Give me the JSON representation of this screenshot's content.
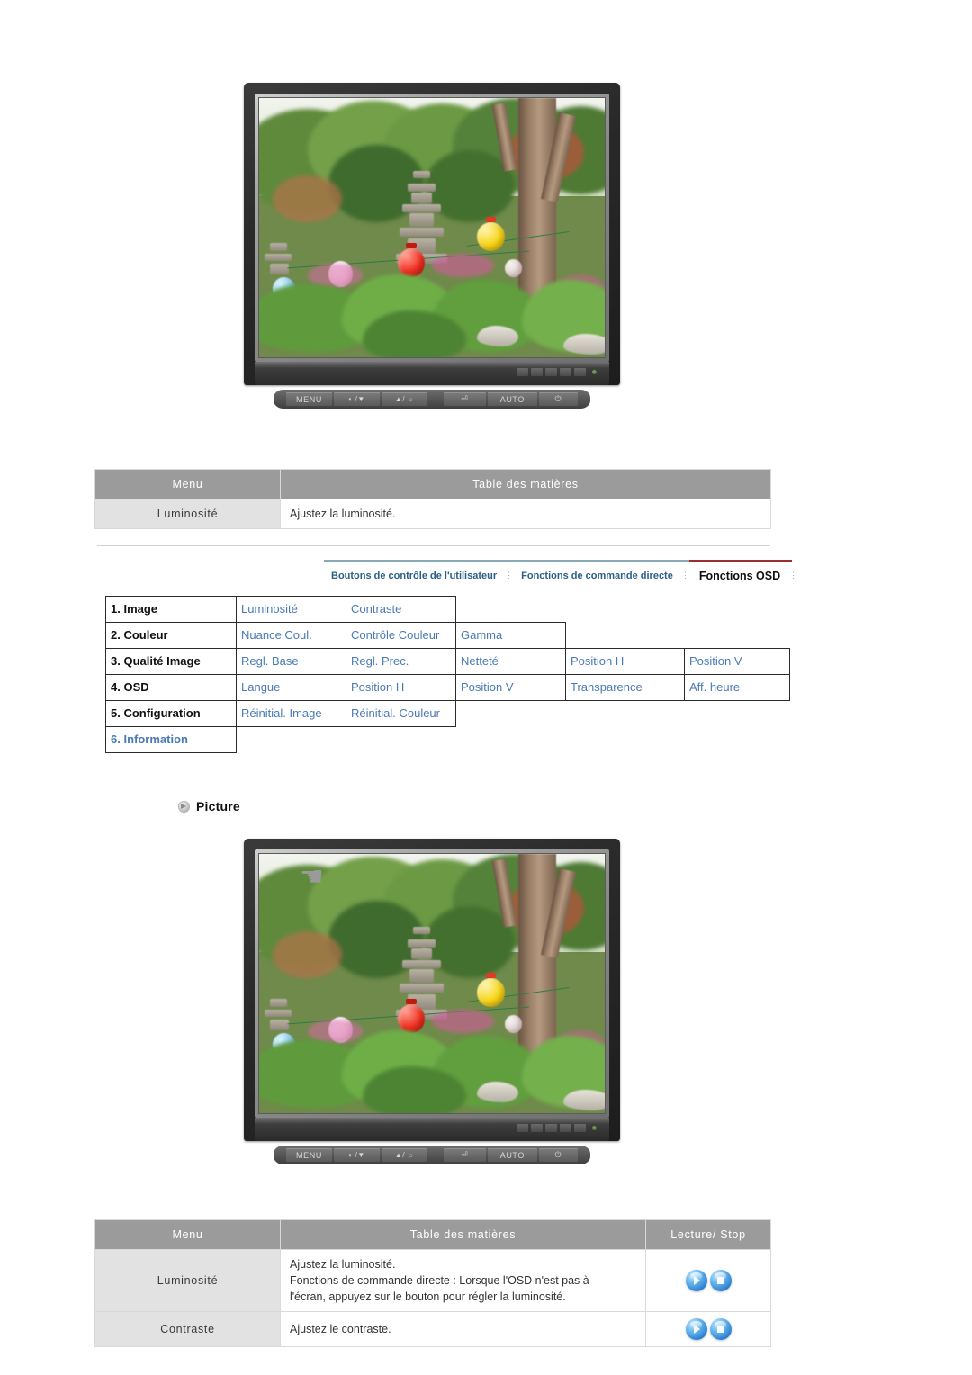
{
  "nav": {
    "items": [
      {
        "label": "Boutons de contrôle de l'utilisateur",
        "active": false
      },
      {
        "label": "Fonctions de commande directe",
        "active": false
      },
      {
        "label": "Fonctions OSD",
        "active": true
      }
    ],
    "separator": "⋮",
    "rule_color": "#8aa9b8",
    "active_rule_color": "#9c2f2f"
  },
  "monitor": {
    "buttons": {
      "menu": "MENU",
      "down": "/▼",
      "up": "▲/",
      "enter": "⏎",
      "auto": "AUTO",
      "power": "⏻"
    },
    "led_color": "#6fbf3a"
  },
  "table_top": {
    "headers": {
      "menu": "Menu",
      "contents": "Table des matières"
    },
    "rows": [
      {
        "menu": "Luminosité",
        "description": "Ajustez la luminosité."
      }
    ]
  },
  "structure_table": {
    "rows": [
      {
        "label": "1. Image",
        "label_style": "black",
        "items": [
          "Luminosité",
          "Contraste"
        ]
      },
      {
        "label": "2. Couleur",
        "label_style": "black",
        "items": [
          "Nuance Coul.",
          "Contrôle Couleur",
          "Gamma"
        ]
      },
      {
        "label": "3. Qualité Image",
        "label_style": "black",
        "items": [
          "Regl. Base",
          "Regl. Prec.",
          "Netteté",
          "Position H",
          "Position V"
        ]
      },
      {
        "label": "4. OSD",
        "label_style": "black",
        "items": [
          "Langue",
          "Position H",
          "Position V",
          "Transparence",
          "Aff. heure"
        ]
      },
      {
        "label": "5. Configuration",
        "label_style": "black",
        "items": [
          "Réinitial. Image",
          "Réinitial. Couleur"
        ]
      },
      {
        "label": "6. Information",
        "label_style": "blue",
        "items": []
      }
    ],
    "text_color": "#4a7ab5",
    "border_color": "#2b2b2b"
  },
  "picture_section": {
    "title": "Picture",
    "bullet_icon": "disc-arrow-icon"
  },
  "table_bottom": {
    "headers": {
      "menu": "Menu",
      "contents": "Table des matières",
      "control": "Lecture/ Stop"
    },
    "rows": [
      {
        "menu": "Luminosité",
        "lines": [
          "Ajustez la luminosité.",
          "Fonctions de commande directe : Lorsque l'OSD n'est pas à",
          "l'écran, appuyez sur le bouton pour régler la luminosité."
        ],
        "play_icon": "play-icon",
        "stop_icon": "stop-icon"
      },
      {
        "menu": "Contraste",
        "lines": [
          "Ajustez le contraste."
        ],
        "play_icon": "play-icon",
        "stop_icon": "stop-icon"
      }
    ]
  }
}
